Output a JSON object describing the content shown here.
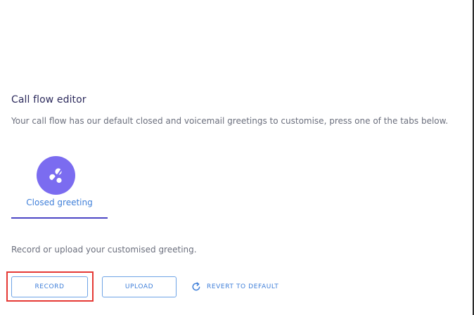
{
  "editor": {
    "title": "Call flow editor",
    "subtitle": "Your call flow has our default closed and voicemail greetings to customise, press one of the tabs below."
  },
  "tabs": [
    {
      "label": "Closed greeting",
      "icon": "closed-greeting-icon",
      "active": true
    }
  ],
  "greeting": {
    "instruction": "Record or upload your customised greeting."
  },
  "actions": {
    "record_label": "RECORD",
    "upload_label": "UPLOAD",
    "revert_label": "REVERT TO DEFAULT",
    "revert_icon": "refresh-icon"
  },
  "colors": {
    "accent": "#3f7fd9",
    "tab_icon_bg": "#7b6cf0",
    "tab_underline": "#4b45c4",
    "highlight": "#e53935"
  }
}
